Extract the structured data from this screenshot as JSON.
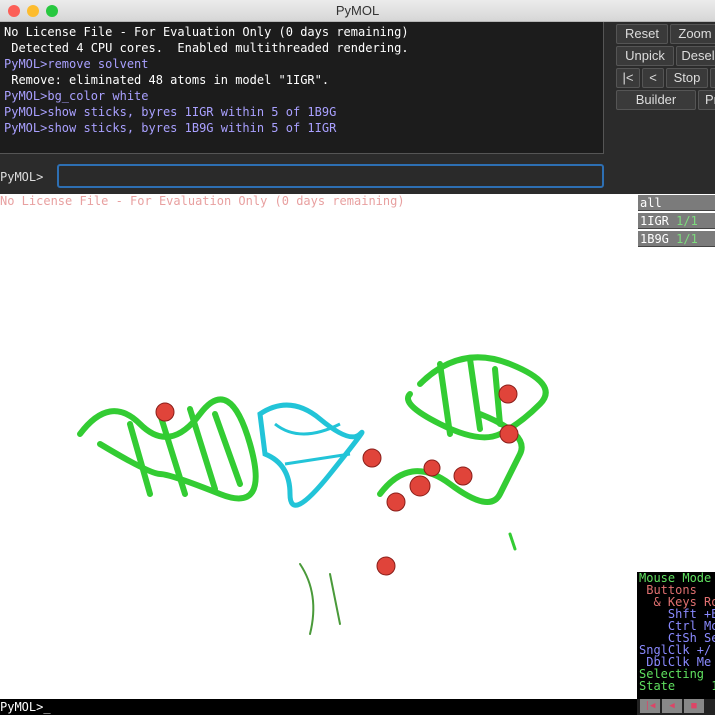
{
  "window": {
    "title": "PyMOL"
  },
  "log": {
    "lines": [
      {
        "text": "No License File - For Evaluation Only (0 days remaining)",
        "type": "out"
      },
      {
        "text": " Detected 4 CPU cores.  Enabled multithreaded rendering.",
        "type": "out"
      },
      {
        "text": "PyMOL>remove solvent",
        "type": "cmd"
      },
      {
        "text": " Remove: eliminated 48 atoms in model \"1IGR\".",
        "type": "out"
      },
      {
        "text": "PyMOL>bg_color white",
        "type": "cmd"
      },
      {
        "text": "PyMOL>show sticks, byres 1IGR within 5 of 1B9G",
        "type": "cmd"
      },
      {
        "text": "PyMOL>show sticks, byres 1B9G within 5 of 1IGR",
        "type": "cmd"
      }
    ]
  },
  "command": {
    "prompt": "PyMOL>",
    "value": ""
  },
  "buttons": {
    "reset": "Reset",
    "zoom": "Zoom",
    "unpick": "Unpick",
    "desel": "Desel",
    "first": "|<",
    "prev": "<",
    "stop": "Stop",
    "builder": "Builder",
    "pr": "Pr"
  },
  "viewer": {
    "license": "No License File - For Evaluation Only (0 days remaining)"
  },
  "objects": [
    {
      "name": "all",
      "state": ""
    },
    {
      "name": "1IGR",
      "state": "1/1"
    },
    {
      "name": "1B9G",
      "state": "1/1"
    }
  ],
  "mouse_mode": [
    {
      "text": "Mouse Mode",
      "color": "#5fe05f"
    },
    {
      "text": " Buttons",
      "color": "#e07070"
    },
    {
      "text": "  & Keys Ro",
      "color": "#e07070"
    },
    {
      "text": "    Shft +B",
      "color": "#8a8aff"
    },
    {
      "text": "    Ctrl Mo",
      "color": "#8a8aff"
    },
    {
      "text": "    CtSh Se",
      "color": "#8a8aff"
    },
    {
      "text": "SnglClk +/",
      "color": "#8a8aff"
    },
    {
      "text": " DblClk Me",
      "color": "#8a8aff"
    },
    {
      "text": "Selecting",
      "color": "#5fe05f"
    },
    {
      "text": "State     1",
      "color": "#5fe05f"
    }
  ],
  "bottom": {
    "prompt": "PyMOL>_"
  },
  "colors": {
    "protein1": "#33cc33",
    "protein2": "#22c4d8",
    "sphere": "#e0443a"
  }
}
